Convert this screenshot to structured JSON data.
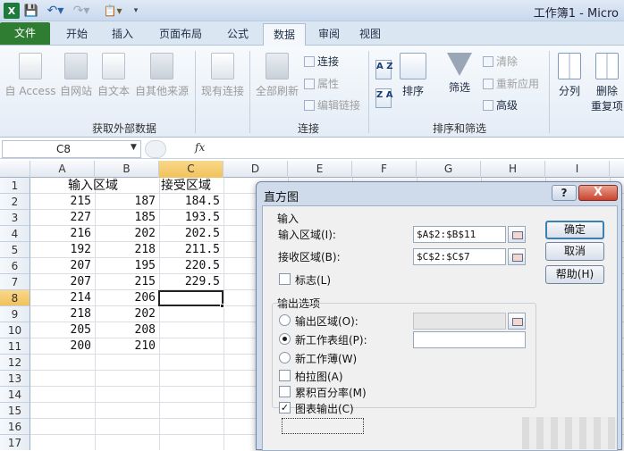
{
  "titlebar": {
    "window_title": "工作簿1 - Micro",
    "app_icon": "X",
    "icons": [
      "excel-icon",
      "save-icon",
      "undo-icon",
      "redo-icon",
      "paste-icon",
      "customize-icon"
    ]
  },
  "tabs": [
    "文件",
    "开始",
    "插入",
    "页面布局",
    "公式",
    "数据",
    "审阅",
    "视图"
  ],
  "active_tab": "数据",
  "ribbon": {
    "get_external": {
      "label": "获取外部数据",
      "access": "自 Access",
      "web": "自网站",
      "text": "自文本",
      "other": "自其他来源",
      "existing": "现有连接"
    },
    "connections": {
      "label": "连接",
      "refresh_all": "全部刷新",
      "connections": "连接",
      "properties": "属性",
      "edit_links": "编辑链接"
    },
    "sort_filter": {
      "label": "排序和筛选",
      "sort": "排序",
      "filter": "筛选",
      "clear": "清除",
      "reapply": "重新应用",
      "advanced": "高级",
      "sort_az": "A Z",
      "sort_za": "Z A"
    },
    "data_tools": {
      "split": "分列",
      "remove_dup": "删除",
      "remove_dup_line2": "重复项"
    }
  },
  "formula_bar": {
    "name_box": "C8",
    "fx": "fx",
    "formula": ""
  },
  "sheet": {
    "columns": [
      "A",
      "B",
      "C",
      "D",
      "E",
      "F",
      "G",
      "H",
      "I"
    ],
    "rows": [
      "1",
      "2",
      "3",
      "4",
      "5",
      "6",
      "7",
      "8",
      "9",
      "10",
      "11",
      "12",
      "13",
      "14",
      "15",
      "16",
      "17"
    ],
    "selected_column": "C",
    "selected_row": "8",
    "header_row": [
      "输入区域",
      "",
      "接受区域"
    ],
    "col_a": [
      "215",
      "227",
      "216",
      "192",
      "207",
      "207",
      "214",
      "218",
      "205",
      "200"
    ],
    "col_b": [
      "187",
      "185",
      "202",
      "218",
      "195",
      "215",
      "206",
      "202",
      "208",
      "210"
    ],
    "col_c": [
      "184.5",
      "193.5",
      "202.5",
      "211.5",
      "220.5",
      "229.5"
    ]
  },
  "dialog": {
    "title": "直方图",
    "help": "?",
    "close": "X",
    "input_section": "输入",
    "input_range_label": "输入区域(I):",
    "input_range_value": "$A$2:$B$11",
    "bin_range_label": "接收区域(B):",
    "bin_range_value": "$C$2:$C$7",
    "labels_label": "标志(L)",
    "output_section": "输出选项",
    "output_range_label": "输出区域(O):",
    "output_range_value": "",
    "new_sheet_label": "新工作表组(P):",
    "new_sheet_value": "",
    "new_workbook_label": "新工作薄(W)",
    "pareto_label": "柏拉图(A)",
    "cumulative_label": "累积百分率(M)",
    "chart_output_label": "图表输出(C)",
    "ok": "确定",
    "cancel": "取消",
    "help_button": "帮助(H)",
    "checkmark": "✓"
  }
}
